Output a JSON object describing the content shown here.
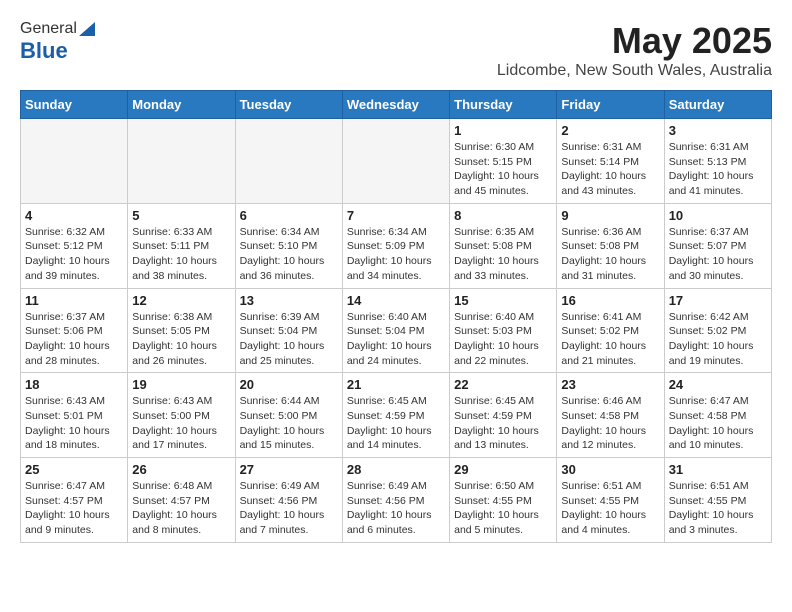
{
  "header": {
    "logo_line1": "General",
    "logo_line2": "Blue",
    "month_title": "May 2025",
    "location": "Lidcombe, New South Wales, Australia"
  },
  "weekdays": [
    "Sunday",
    "Monday",
    "Tuesday",
    "Wednesday",
    "Thursday",
    "Friday",
    "Saturday"
  ],
  "weeks": [
    [
      {
        "day": "",
        "info": ""
      },
      {
        "day": "",
        "info": ""
      },
      {
        "day": "",
        "info": ""
      },
      {
        "day": "",
        "info": ""
      },
      {
        "day": "1",
        "info": "Sunrise: 6:30 AM\nSunset: 5:15 PM\nDaylight: 10 hours\nand 45 minutes."
      },
      {
        "day": "2",
        "info": "Sunrise: 6:31 AM\nSunset: 5:14 PM\nDaylight: 10 hours\nand 43 minutes."
      },
      {
        "day": "3",
        "info": "Sunrise: 6:31 AM\nSunset: 5:13 PM\nDaylight: 10 hours\nand 41 minutes."
      }
    ],
    [
      {
        "day": "4",
        "info": "Sunrise: 6:32 AM\nSunset: 5:12 PM\nDaylight: 10 hours\nand 39 minutes."
      },
      {
        "day": "5",
        "info": "Sunrise: 6:33 AM\nSunset: 5:11 PM\nDaylight: 10 hours\nand 38 minutes."
      },
      {
        "day": "6",
        "info": "Sunrise: 6:34 AM\nSunset: 5:10 PM\nDaylight: 10 hours\nand 36 minutes."
      },
      {
        "day": "7",
        "info": "Sunrise: 6:34 AM\nSunset: 5:09 PM\nDaylight: 10 hours\nand 34 minutes."
      },
      {
        "day": "8",
        "info": "Sunrise: 6:35 AM\nSunset: 5:08 PM\nDaylight: 10 hours\nand 33 minutes."
      },
      {
        "day": "9",
        "info": "Sunrise: 6:36 AM\nSunset: 5:08 PM\nDaylight: 10 hours\nand 31 minutes."
      },
      {
        "day": "10",
        "info": "Sunrise: 6:37 AM\nSunset: 5:07 PM\nDaylight: 10 hours\nand 30 minutes."
      }
    ],
    [
      {
        "day": "11",
        "info": "Sunrise: 6:37 AM\nSunset: 5:06 PM\nDaylight: 10 hours\nand 28 minutes."
      },
      {
        "day": "12",
        "info": "Sunrise: 6:38 AM\nSunset: 5:05 PM\nDaylight: 10 hours\nand 26 minutes."
      },
      {
        "day": "13",
        "info": "Sunrise: 6:39 AM\nSunset: 5:04 PM\nDaylight: 10 hours\nand 25 minutes."
      },
      {
        "day": "14",
        "info": "Sunrise: 6:40 AM\nSunset: 5:04 PM\nDaylight: 10 hours\nand 24 minutes."
      },
      {
        "day": "15",
        "info": "Sunrise: 6:40 AM\nSunset: 5:03 PM\nDaylight: 10 hours\nand 22 minutes."
      },
      {
        "day": "16",
        "info": "Sunrise: 6:41 AM\nSunset: 5:02 PM\nDaylight: 10 hours\nand 21 minutes."
      },
      {
        "day": "17",
        "info": "Sunrise: 6:42 AM\nSunset: 5:02 PM\nDaylight: 10 hours\nand 19 minutes."
      }
    ],
    [
      {
        "day": "18",
        "info": "Sunrise: 6:43 AM\nSunset: 5:01 PM\nDaylight: 10 hours\nand 18 minutes."
      },
      {
        "day": "19",
        "info": "Sunrise: 6:43 AM\nSunset: 5:00 PM\nDaylight: 10 hours\nand 17 minutes."
      },
      {
        "day": "20",
        "info": "Sunrise: 6:44 AM\nSunset: 5:00 PM\nDaylight: 10 hours\nand 15 minutes."
      },
      {
        "day": "21",
        "info": "Sunrise: 6:45 AM\nSunset: 4:59 PM\nDaylight: 10 hours\nand 14 minutes."
      },
      {
        "day": "22",
        "info": "Sunrise: 6:45 AM\nSunset: 4:59 PM\nDaylight: 10 hours\nand 13 minutes."
      },
      {
        "day": "23",
        "info": "Sunrise: 6:46 AM\nSunset: 4:58 PM\nDaylight: 10 hours\nand 12 minutes."
      },
      {
        "day": "24",
        "info": "Sunrise: 6:47 AM\nSunset: 4:58 PM\nDaylight: 10 hours\nand 10 minutes."
      }
    ],
    [
      {
        "day": "25",
        "info": "Sunrise: 6:47 AM\nSunset: 4:57 PM\nDaylight: 10 hours\nand 9 minutes."
      },
      {
        "day": "26",
        "info": "Sunrise: 6:48 AM\nSunset: 4:57 PM\nDaylight: 10 hours\nand 8 minutes."
      },
      {
        "day": "27",
        "info": "Sunrise: 6:49 AM\nSunset: 4:56 PM\nDaylight: 10 hours\nand 7 minutes."
      },
      {
        "day": "28",
        "info": "Sunrise: 6:49 AM\nSunset: 4:56 PM\nDaylight: 10 hours\nand 6 minutes."
      },
      {
        "day": "29",
        "info": "Sunrise: 6:50 AM\nSunset: 4:55 PM\nDaylight: 10 hours\nand 5 minutes."
      },
      {
        "day": "30",
        "info": "Sunrise: 6:51 AM\nSunset: 4:55 PM\nDaylight: 10 hours\nand 4 minutes."
      },
      {
        "day": "31",
        "info": "Sunrise: 6:51 AM\nSunset: 4:55 PM\nDaylight: 10 hours\nand 3 minutes."
      }
    ]
  ]
}
